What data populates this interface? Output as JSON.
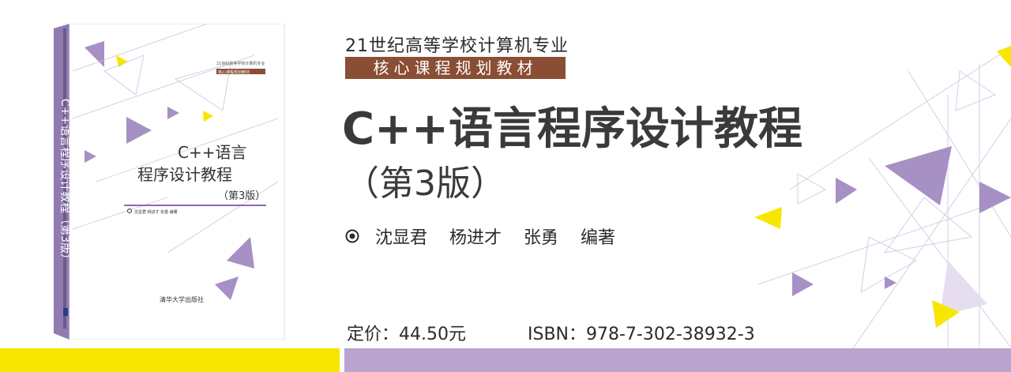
{
  "series": {
    "line1": "21世纪高等学校计算机专业",
    "line2": "核心课程规划教材"
  },
  "title": "C++语言程序设计教程",
  "edition": "（第3版）",
  "authors": {
    "names": [
      "沈显君",
      "杨进才",
      "张勇"
    ],
    "role": "编著"
  },
  "price": "定价：44.50元",
  "isbn": "ISBN：978-7-302-38932-3",
  "book_cover": {
    "series_line1": "21世纪高等学校计算机专业",
    "series_line2": "核心课程规划教材",
    "title_line1": "C++语言",
    "title_line2": "程序设计教程",
    "edition": "（第3版）",
    "authors": "沈显君   杨进才   张勇   编著",
    "spine_title": "C++语言程序设计教程（第3版）",
    "publisher": "清华大学出版社"
  },
  "colors": {
    "accent_purple": "#b9a3cf",
    "accent_yellow": "#f7e600",
    "badge_brown": "#8a4e34"
  }
}
